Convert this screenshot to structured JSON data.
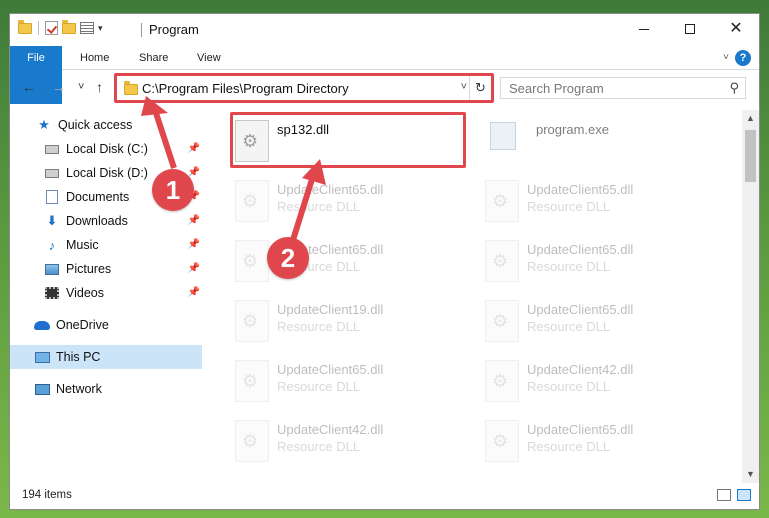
{
  "window": {
    "title": "Program",
    "controls": {
      "minimize": "–",
      "maximize": "☐",
      "close": "✕"
    }
  },
  "quick_access_toolbar": {
    "icons": [
      "folder-icon",
      "properties-check-icon",
      "new-folder-icon",
      "properties-icon",
      "customize-dropdown-icon"
    ]
  },
  "ribbon": {
    "tabs": [
      {
        "label": "File",
        "active": true
      },
      {
        "label": "Home"
      },
      {
        "label": "Share"
      },
      {
        "label": "View"
      }
    ],
    "help": "?"
  },
  "navigation": {
    "back": "←",
    "forward": "→",
    "recent": "˅",
    "up": "↑"
  },
  "address_bar": {
    "path": "C:\\Program Files\\Program Directory",
    "dropdown": "˅",
    "refresh": "↻"
  },
  "search": {
    "placeholder": "Search Program",
    "icon": "search-icon"
  },
  "nav_pane": {
    "items": [
      {
        "label": "Quick access",
        "icon": "star-icon"
      },
      {
        "label": "Local Disk (C:)",
        "icon": "drive-icon",
        "pinned": true
      },
      {
        "label": "Local Disk (D:)",
        "icon": "drive-icon",
        "pinned": true
      },
      {
        "label": "Documents",
        "icon": "documents-icon",
        "pinned": true
      },
      {
        "label": "Downloads",
        "icon": "download-icon",
        "pinned": true
      },
      {
        "label": "Music",
        "icon": "music-icon",
        "pinned": true
      },
      {
        "label": "Pictures",
        "icon": "pictures-icon",
        "pinned": true
      },
      {
        "label": "Videos",
        "icon": "videos-icon",
        "pinned": true
      },
      {
        "label": "OneDrive",
        "icon": "onedrive-icon"
      },
      {
        "label": "This PC",
        "icon": "pc-icon",
        "selected": true
      },
      {
        "label": "Network",
        "icon": "network-icon"
      }
    ]
  },
  "files": [
    {
      "name": "sp132.dll",
      "type": "",
      "highlighted": true
    },
    {
      "name": "program.exe",
      "type": ""
    },
    {
      "name": "UpdateClient65.dll",
      "type": "Resource DLL"
    },
    {
      "name": "UpdateClient65.dll",
      "type": "Resource DLL"
    },
    {
      "name": "UpdateClient65.dll",
      "type": "Resource DLL"
    },
    {
      "name": "UpdateClient65.dll",
      "type": "Resource DLL"
    },
    {
      "name": "UpdateClient19.dll",
      "type": "Resource DLL"
    },
    {
      "name": "UpdateClient65.dll",
      "type": "Resource DLL"
    },
    {
      "name": "UpdateClient65.dll",
      "type": "Resource DLL"
    },
    {
      "name": "UpdateClient42.dll",
      "type": "Resource DLL"
    },
    {
      "name": "UpdateClient42.dll",
      "type": "Resource DLL"
    },
    {
      "name": "UpdateClient65.dll",
      "type": "Resource DLL"
    }
  ],
  "status_bar": {
    "item_count": "194 items"
  },
  "callouts": [
    {
      "number": "1",
      "target": "address-bar"
    },
    {
      "number": "2",
      "target": "sp132-dll-file"
    }
  ],
  "colors": {
    "accent": "#1979ca",
    "highlight": "#e0474c",
    "selected": "#cce4f7"
  }
}
